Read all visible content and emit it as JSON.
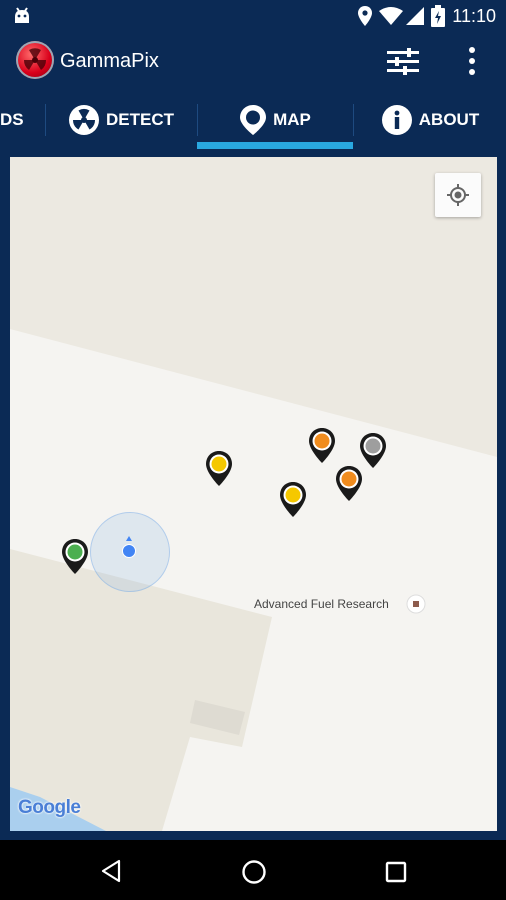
{
  "status_bar": {
    "time": "11:10"
  },
  "app": {
    "title": "GammaPix"
  },
  "tabs": [
    {
      "label": "DS"
    },
    {
      "label": "DETECT"
    },
    {
      "label": "MAP"
    },
    {
      "label": "ABOUT"
    }
  ],
  "map": {
    "place_label": "Advanced Fuel Research",
    "attribution": "Google"
  },
  "colors": {
    "primary": "#0b2a55",
    "tab_indicator": "#29a8e0",
    "pin_green": "#4caf50",
    "pin_yellow": "#f5c800",
    "pin_orange": "#f08c1e",
    "pin_gray": "#9e9e9e"
  }
}
